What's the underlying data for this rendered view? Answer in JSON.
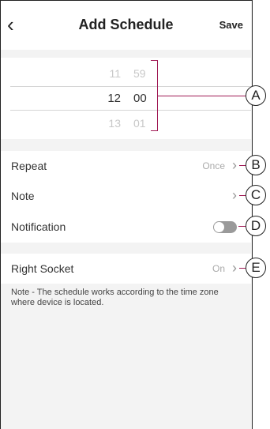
{
  "header": {
    "title": "Add Schedule",
    "save_label": "Save"
  },
  "picker": {
    "rows": [
      {
        "hour": "11",
        "minute": "59"
      },
      {
        "hour": "12",
        "minute": "00"
      },
      {
        "hour": "13",
        "minute": "01"
      }
    ]
  },
  "settings": {
    "repeat": {
      "label": "Repeat",
      "value": "Once"
    },
    "note": {
      "label": "Note"
    },
    "notification": {
      "label": "Notification",
      "enabled": false
    }
  },
  "socket": {
    "label": "Right Socket",
    "value": "On"
  },
  "note_text": "Note - The schedule works according to the time zone where device is located.",
  "callouts": [
    "A",
    "B",
    "C",
    "D",
    "E"
  ],
  "colors": {
    "accent": "#a01a55",
    "toggle_off": "#9a9a9a"
  }
}
